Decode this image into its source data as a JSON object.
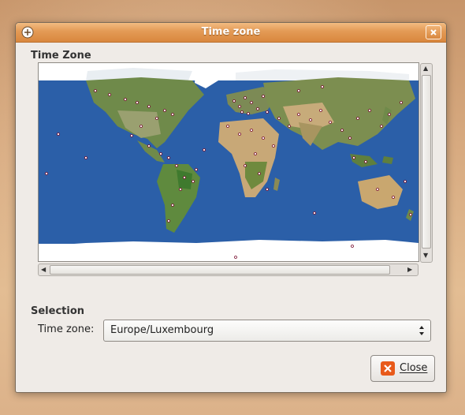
{
  "window": {
    "title": "Time zone"
  },
  "map_section": {
    "heading": "Time Zone"
  },
  "selection": {
    "heading": "Selection",
    "timezone_label": "Time zone:",
    "timezone_value": "Europe/Luxembourg"
  },
  "buttons": {
    "close_label": "Close"
  },
  "colors": {
    "titlebar": "#e39a55",
    "ocean": "#2b5fa8",
    "accent_close": "#e85a1a"
  },
  "icons": [
    "window-menu-icon",
    "window-close-icon",
    "scroll-up-icon",
    "scroll-down-icon",
    "scroll-left-icon",
    "scroll-right-icon",
    "combo-arrows-icon",
    "close-x-icon"
  ]
}
